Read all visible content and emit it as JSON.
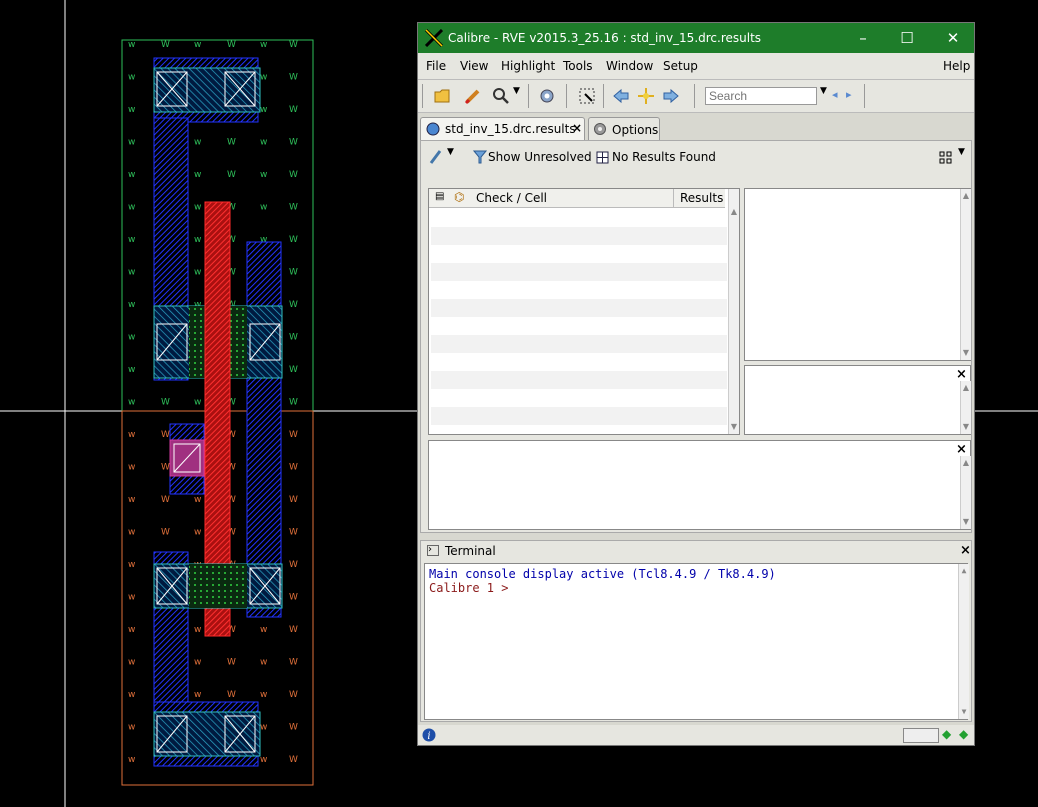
{
  "layout_view": {
    "well_labels": [
      "w",
      "W"
    ],
    "colors": {
      "background": "#000000",
      "crosshair": "#ffffff",
      "nwell_outline": "#2ec05a",
      "pwell_outline": "#e0703a",
      "metal": "#2233ff",
      "poly": "#ff2a2a",
      "diffusion": "#30c0c0",
      "contact": "#ffffff",
      "via": "#d03aa0"
    }
  },
  "window": {
    "title": "Calibre - RVE v2015.3_25.16 : std_inv_15.drc.results",
    "title_bar_color": "#1e7d2a",
    "controls": {
      "minimize": "–",
      "maximize": "☐",
      "close": "✕"
    }
  },
  "menu": {
    "left": [
      "File",
      "View",
      "Highlight",
      "Tools",
      "Window",
      "Setup"
    ],
    "right": "Help"
  },
  "toolbar": {
    "icons": [
      "open-folder-icon",
      "highlight-brush-icon",
      "zoom-icon",
      "gear-icon",
      "grid-select-icon",
      "arrow-left-icon",
      "center-icon",
      "arrow-right-icon"
    ],
    "search_placeholder": "Search"
  },
  "tabs": [
    {
      "label": "std_inv_15.drc.results",
      "active": true,
      "closable": "×"
    },
    {
      "label": "Options",
      "active": false
    }
  ],
  "results_bar": {
    "show_unresolved": "Show Unresolved",
    "no_results": "No Results Found"
  },
  "tree": {
    "col_check": "Check / Cell",
    "col_results": "Results"
  },
  "pane_close": "×",
  "terminal": {
    "title": "Terminal",
    "close": "×",
    "line1": "Main console display active (Tcl8.4.9 / Tk8.4.9)",
    "line2": "Calibre 1 >",
    "line1_color": "#0000aa",
    "line2_color": "#8b1a1a"
  },
  "status": {
    "info_icon": "info-icon",
    "indicators": [
      "green-diamond-icon",
      "green-diamond-icon"
    ]
  }
}
